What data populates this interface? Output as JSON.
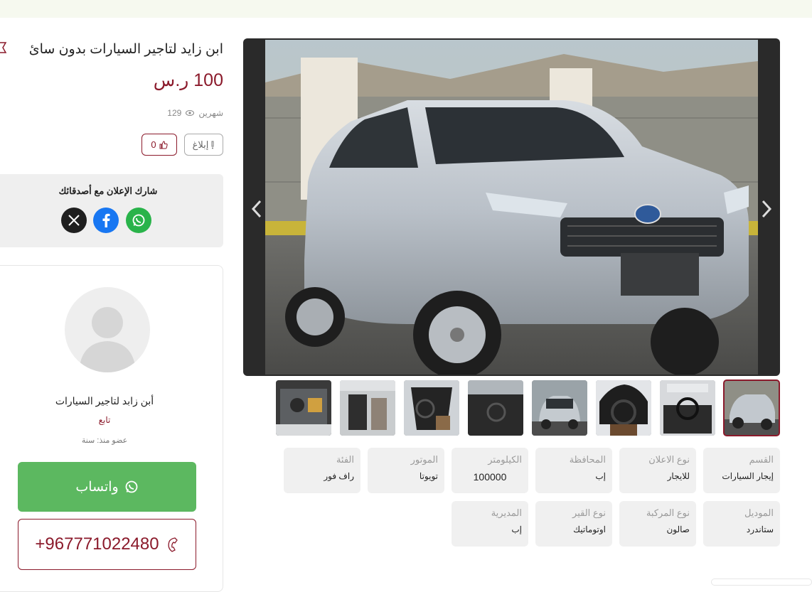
{
  "listing": {
    "title": "ابن زايد لتاجير السيارات بدون سائ",
    "price": "100 ر.س",
    "time_ago": "شهرين",
    "views": "129",
    "report_label": "إبلاغ",
    "likes": "0"
  },
  "share": {
    "title": "شارك الإعلان مع أصدقائك",
    "networks": [
      "whatsapp-icon",
      "facebook-icon",
      "x-icon"
    ]
  },
  "seller": {
    "name": "أبن زابد لتاجير السيارات",
    "follow_label": "تابع",
    "member_since": "عضو منذ: سنة",
    "whatsapp_label": "واتساب",
    "phone": "+967771022480"
  },
  "specs": [
    {
      "label": "القسم",
      "value": "إيجار السيارات"
    },
    {
      "label": "نوع الاعلان",
      "value": "للايجار"
    },
    {
      "label": "المحافظة",
      "value": "إب"
    },
    {
      "label": "الكيلومتر",
      "value": "100000"
    },
    {
      "label": "الموتور",
      "value": "تويوتا"
    },
    {
      "label": "الفئة",
      "value": "راف فور"
    },
    {
      "label": "الموديل",
      "value": "ستاندرد"
    },
    {
      "label": "نوع المركبة",
      "value": "صالون"
    },
    {
      "label": "نوع القير",
      "value": "اوتوماتيك"
    },
    {
      "label": "المديرية",
      "value": "إب"
    }
  ],
  "gallery": {
    "thumb_count": 8,
    "active_thumb": 1
  },
  "colors": {
    "accent": "#8b1a2b",
    "whatsapp": "#5cb860",
    "card_bg": "#f0f0f0"
  }
}
